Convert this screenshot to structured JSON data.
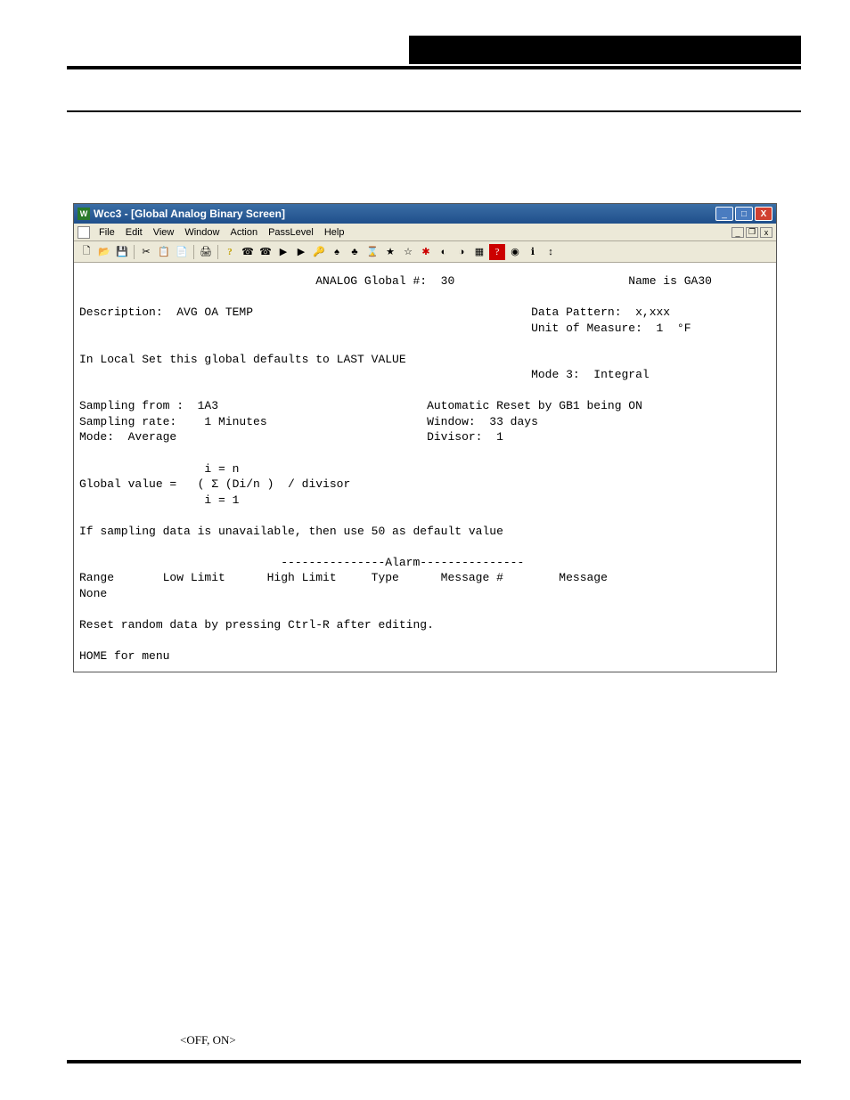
{
  "window": {
    "title": "Wcc3 - [Global Analog Binary Screen]",
    "menus": [
      "File",
      "Edit",
      "View",
      "Window",
      "Action",
      "PassLevel",
      "Help"
    ]
  },
  "content": {
    "line01": "                                  ANALOG Global #:  30                         Name is GA30",
    "line02": "",
    "line03": "Description:  AVG OA TEMP                                        Data Pattern:  x,xxx",
    "line04": "                                                                 Unit of Measure:  1  °F",
    "line05": "",
    "line06": "In Local Set this global defaults to LAST VALUE",
    "line07": "                                                                 Mode 3:  Integral",
    "line08": "",
    "line09": "Sampling from :  1A3                              Automatic Reset by GB1 being ON",
    "line10": "Sampling rate:    1 Minutes                       Window:  33 days",
    "line11": "Mode:  Average                                    Divisor:  1",
    "line12": "",
    "line13": "                  i = n",
    "line14": "Global value =   ( Σ (Di/n )  / divisor",
    "line15": "                  i = 1",
    "line16": "",
    "line17": "If sampling data is unavailable, then use 50 as default value",
    "line18": "",
    "line19": "                             ---------------Alarm---------------",
    "line20": "Range       Low Limit      High Limit     Type      Message #        Message",
    "line21": "None",
    "line22": "",
    "line23": "Reset random data by pressing Ctrl-R after editing.",
    "line24": "",
    "line25": "HOME for menu"
  },
  "body_text_1": "<OFF, ON>"
}
